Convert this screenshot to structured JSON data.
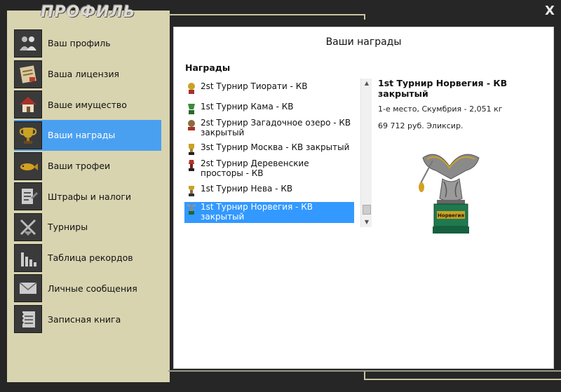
{
  "window": {
    "title": "ПРОФИЛЬ",
    "close_label": "X"
  },
  "menu": {
    "items": [
      {
        "label": "Ваш профиль",
        "icon": "users-icon"
      },
      {
        "label": "Ваша лицензия",
        "icon": "license-icon"
      },
      {
        "label": "Ваше имущество",
        "icon": "house-icon"
      },
      {
        "label": "Ваши награды",
        "icon": "trophy-icon",
        "active": true
      },
      {
        "label": "Ваши трофеи",
        "icon": "fish-icon"
      },
      {
        "label": "Штрафы и налоги",
        "icon": "document-icon"
      },
      {
        "label": "Турниры",
        "icon": "swords-icon"
      },
      {
        "label": "Таблица рекордов",
        "icon": "bar-chart-icon"
      },
      {
        "label": "Личные сообщения",
        "icon": "envelope-icon"
      },
      {
        "label": "Записная книга",
        "icon": "notebook-icon"
      }
    ]
  },
  "content": {
    "title": "Ваши награды",
    "awards_heading": "Награды",
    "awards": [
      {
        "text": "2st Турнир Тиорати - КВ"
      },
      {
        "text": "1st Турнир Кама - КВ"
      },
      {
        "text": "2st Турнир Загадочное озеро - КВ закрытый"
      },
      {
        "text": "3st Турнир Москва - КВ закрытый"
      },
      {
        "text": "2st Турнир Деревенские просторы - КВ"
      },
      {
        "text": "1st Турнир Нева - КВ"
      },
      {
        "text": "1st Турнир Норвегия - КВ закрытый",
        "selected": true
      }
    ],
    "detail": {
      "title": "1st Турнир Норвегия - КВ закрытый",
      "line1": "1-е место, Скумбрия - 2,051 кг",
      "line2": "69 712 руб. Эликсир.",
      "trophy_plate": "Норвегия"
    }
  },
  "colors": {
    "active_menu": "#4aa0f0",
    "selected_item": "#3399ff",
    "panel": "#d8d4b0",
    "frame": "#262626"
  }
}
